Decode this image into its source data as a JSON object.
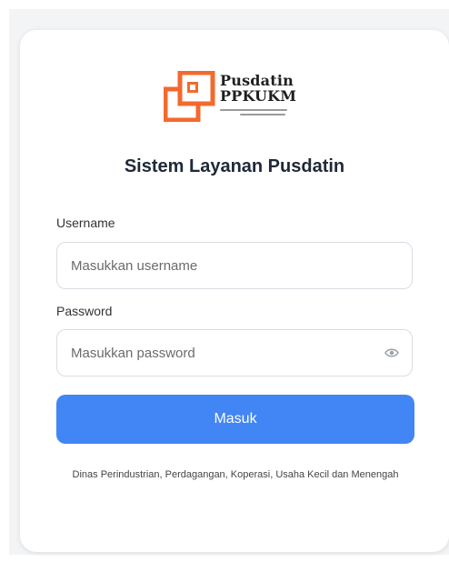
{
  "brand": {
    "logo_line1": "Pusdatin",
    "logo_line2": "PPKUKM",
    "accent_color": "#f26a2e"
  },
  "title": "Sistem Layanan Pusdatin",
  "form": {
    "username_label": "Username",
    "username_placeholder": "Masukkan username",
    "username_value": "",
    "password_label": "Password",
    "password_placeholder": "Masukkan password",
    "password_value": "",
    "password_toggle_icon": "eye-icon",
    "submit_label": "Masuk",
    "submit_color": "#4285f4"
  },
  "footer": {
    "text": "Dinas Perindustrian, Perdagangan, Koperasi, Usaha Kecil dan Menengah"
  }
}
